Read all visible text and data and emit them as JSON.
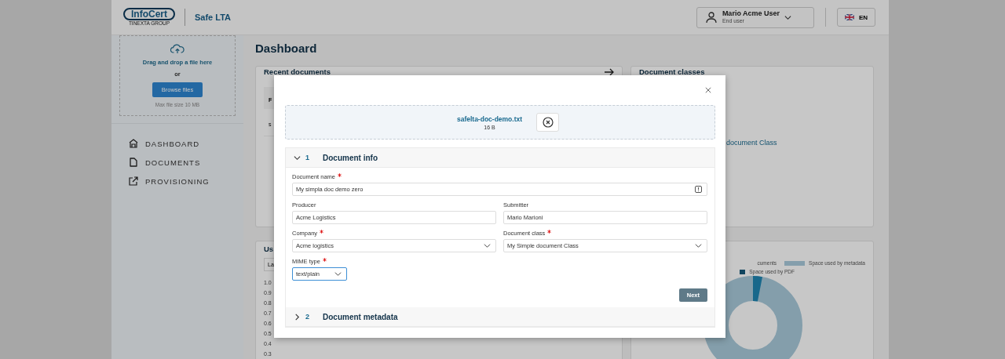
{
  "header": {
    "logo": {
      "name": "InfoCert",
      "group": "TINEXTA GROUP"
    },
    "app_name": "Safe LTA",
    "user": {
      "name": "Mario Acme User",
      "role": "End user"
    },
    "language": "EN"
  },
  "sidebar": {
    "upload": {
      "title": "Drag and drop a file here",
      "separator": "or",
      "button": "Browse files",
      "hint": "Max file size 10 MB"
    },
    "nav": [
      {
        "label": "DASHBOARD",
        "kind": "home"
      },
      {
        "label": "DOCUMENTS",
        "kind": "document"
      },
      {
        "label": "PROVISIONING",
        "kind": "external"
      }
    ]
  },
  "main": {
    "title": "Dashboard",
    "recent_documents": {
      "title": "Recent documents",
      "column_1": "F",
      "cell": "s"
    },
    "document_classes": {
      "title": "Document classes",
      "item": "document Class"
    },
    "usage": {
      "title": "Us",
      "filter": "La",
      "y_labels": [
        "1.0",
        "0.9",
        "0.8",
        "0.7",
        "0.6",
        "0.5",
        "0.4",
        "0.3"
      ]
    },
    "storage": {
      "legend": [
        {
          "label": "cuments"
        },
        {
          "label": "Space used by metadata",
          "color": "#849eac"
        },
        {
          "label": "Space used by PDF",
          "color": "#11455f"
        }
      ]
    }
  },
  "modal": {
    "file": {
      "name": "safelta-doc-demo.txt",
      "size": "16 B"
    },
    "steps": [
      {
        "number": "1",
        "title": "Document info",
        "expanded": true,
        "fields": [
          {
            "label": "Document name",
            "required": true,
            "kind": "text-icon",
            "value": "My simpla doc demo zero",
            "focused": false
          },
          {
            "label": "Producer",
            "required": false,
            "kind": "text",
            "value": "Acme Logistics",
            "focused": false
          },
          {
            "label": "Submitter",
            "required": false,
            "kind": "text",
            "value": "Mario Marioni",
            "focused": false
          },
          {
            "label": "Company",
            "required": true,
            "kind": "select",
            "value": "Acme logistics",
            "focused": false
          },
          {
            "label": "Document class",
            "required": true,
            "kind": "select",
            "value": "My Simple document Class",
            "focused": false
          },
          {
            "label": "MIME type",
            "required": true,
            "kind": "inline-select",
            "value": "text/plain",
            "focused": true
          }
        ],
        "button": "Next"
      },
      {
        "number": "2",
        "title": "Document metadata",
        "expanded": false
      }
    ]
  }
}
